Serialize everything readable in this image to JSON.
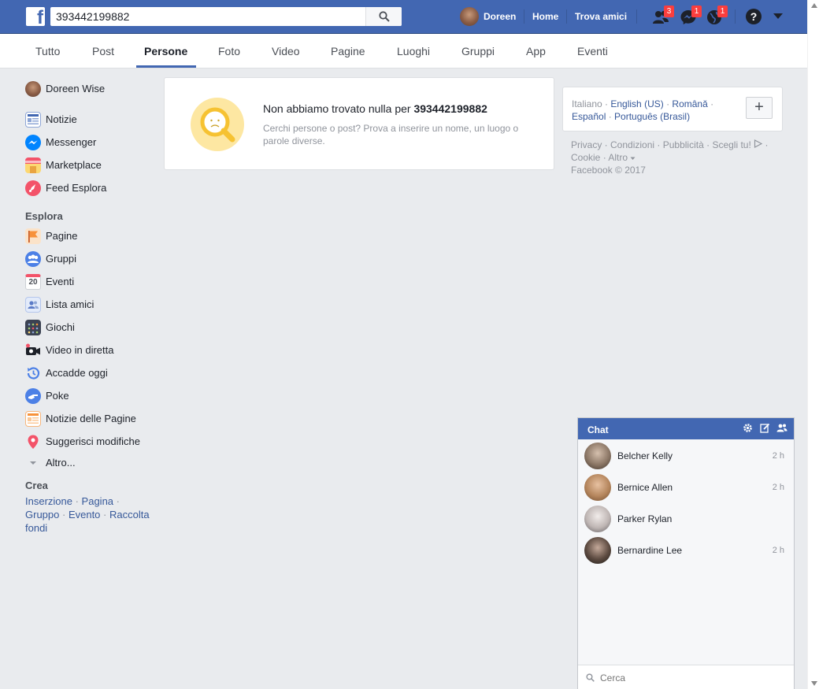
{
  "topbar": {
    "logo": "f",
    "search_value": "393442199882",
    "user_name": "Doreen",
    "home_label": "Home",
    "find_friends_label": "Trova amici",
    "friend_requests_count": "3",
    "messages_count": "1",
    "notifications_count": "1",
    "help_glyph": "?",
    "brand_color": "#4267b2"
  },
  "tabs": [
    {
      "label": "Tutto"
    },
    {
      "label": "Post"
    },
    {
      "label": "Persone",
      "active": true
    },
    {
      "label": "Foto"
    },
    {
      "label": "Video"
    },
    {
      "label": "Pagine"
    },
    {
      "label": "Luoghi"
    },
    {
      "label": "Gruppi"
    },
    {
      "label": "App"
    },
    {
      "label": "Eventi"
    }
  ],
  "sidebar": {
    "profile_name": "Doreen Wise",
    "main_items": [
      {
        "label": "Notizie",
        "icon": "news-feed-icon"
      },
      {
        "label": "Messenger",
        "icon": "messenger-icon"
      },
      {
        "label": "Marketplace",
        "icon": "marketplace-icon"
      },
      {
        "label": "Feed Esplora",
        "icon": "explore-feed-icon"
      }
    ],
    "explore_heading": "Esplora",
    "explore_items": [
      {
        "label": "Pagine",
        "icon": "pages-flag-icon"
      },
      {
        "label": "Gruppi",
        "icon": "groups-icon"
      },
      {
        "label": "Eventi",
        "icon": "calendar-icon",
        "icon_text": "20"
      },
      {
        "label": "Lista amici",
        "icon": "friend-list-icon"
      },
      {
        "label": "Giochi",
        "icon": "games-icon"
      },
      {
        "label": "Video in diretta",
        "icon": "live-video-icon"
      },
      {
        "label": "Accadde oggi",
        "icon": "on-this-day-icon"
      },
      {
        "label": "Poke",
        "icon": "poke-icon"
      },
      {
        "label": "Notizie delle Pagine",
        "icon": "pages-feed-icon"
      },
      {
        "label": "Suggerisci modifiche",
        "icon": "map-pin-icon"
      }
    ],
    "more_label": "Altro...",
    "create_heading": "Crea",
    "create_links": [
      "Inserzione",
      "Pagina",
      "Gruppo",
      "Evento",
      "Raccolta fondi"
    ]
  },
  "result": {
    "title_prefix": "Non abbiamo trovato nulla per",
    "query": "393442199882",
    "subtitle": "Cerchi persone o post? Prova a inserire un nome, un luogo o parole diverse."
  },
  "languages": {
    "current": "Italiano",
    "options": [
      "English (US)",
      "Română",
      "Español",
      "Português (Brasil)"
    ],
    "add_label": "+"
  },
  "footer": {
    "links": [
      "Privacy",
      "Condizioni",
      "Pubblicità",
      "Scegli tu!",
      "Cookie",
      "Altro"
    ],
    "copyright": "Facebook © 2017"
  },
  "chat": {
    "title": "Chat",
    "contacts": [
      {
        "name": "Belcher Kelly",
        "time": "2 h"
      },
      {
        "name": "Bernice Allen",
        "time": "2 h"
      },
      {
        "name": "Parker Rylan",
        "time": ""
      },
      {
        "name": "Bernardine Lee",
        "time": "2 h"
      }
    ],
    "search_placeholder": "Cerca"
  }
}
